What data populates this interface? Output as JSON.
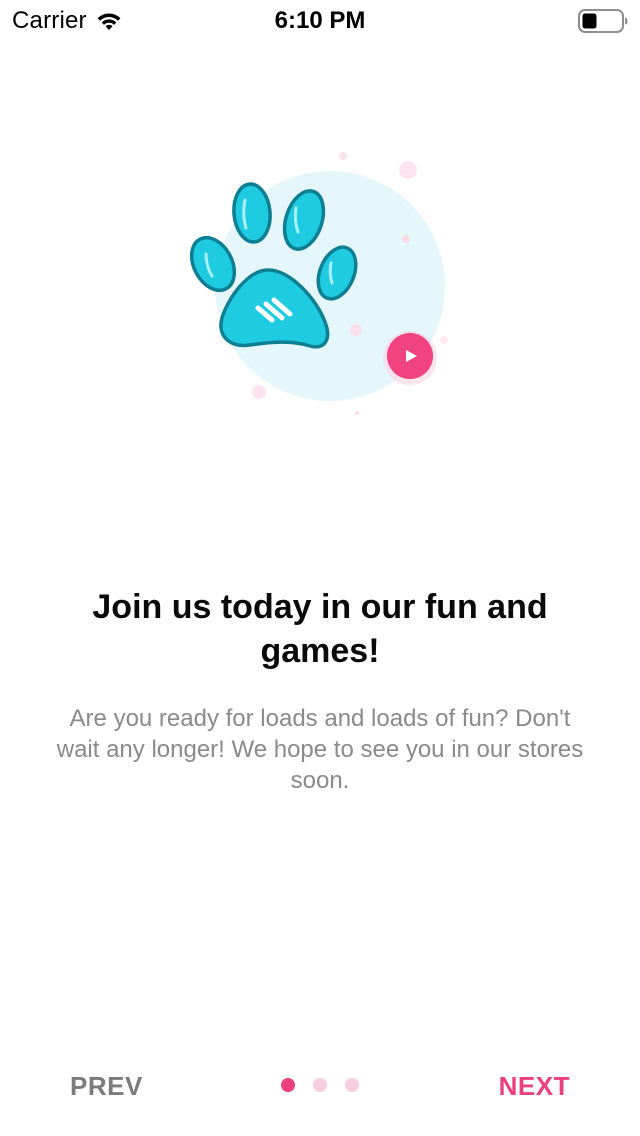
{
  "status_bar": {
    "carrier": "Carrier",
    "time": "6:10 PM",
    "wifi_icon": "wifi-icon",
    "battery_icon": "battery-icon"
  },
  "illustration": {
    "paw_icon": "paw-icon",
    "play_icon": "play-icon",
    "paw_color": "#1ecbe1",
    "paw_outline": "#0e7f93",
    "circle_color": "#e6f7fc",
    "play_color": "#f0437f"
  },
  "content": {
    "headline": "Join us today in our fun and games!",
    "description": "Are you ready for loads and loads of fun? Don't wait any longer! We hope to see you in our stores soon."
  },
  "navigation": {
    "prev_label": "PREV",
    "next_label": "NEXT",
    "total_pages": 3,
    "current_page": 1,
    "accent_color": "#e8417d"
  }
}
